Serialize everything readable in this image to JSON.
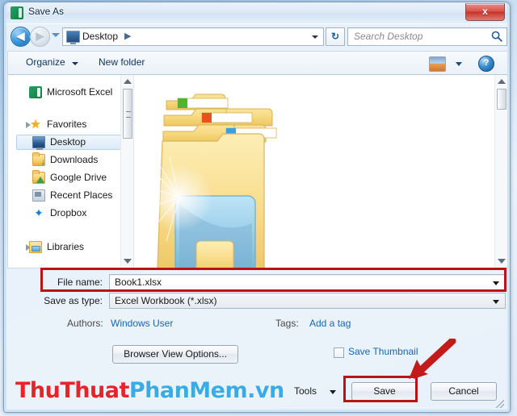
{
  "window": {
    "title": "Save As",
    "app_icon": "excel-icon",
    "close_label": "x"
  },
  "navigation": {
    "back_glyph": "◀",
    "forward_glyph": "▶",
    "address_text": "Desktop",
    "address_separator": "▶",
    "refresh_glyph": "↻",
    "search_placeholder": "Search Desktop"
  },
  "toolbar": {
    "organize_label": "Organize",
    "new_folder_label": "New folder",
    "help_label": "?"
  },
  "sidebar": {
    "header": {
      "label": "Microsoft Excel",
      "icon": "excel-icon"
    },
    "groups": [
      {
        "label": "Favorites",
        "icon": "star-icon",
        "items": [
          {
            "label": "Desktop",
            "icon": "desktop-icon",
            "selected": true
          },
          {
            "label": "Downloads",
            "icon": "downloads-folder-icon",
            "selected": false
          },
          {
            "label": "Google Drive",
            "icon": "google-drive-icon",
            "selected": false
          },
          {
            "label": "Recent Places",
            "icon": "recent-places-icon",
            "selected": false
          },
          {
            "label": "Dropbox",
            "icon": "dropbox-icon",
            "selected": false
          }
        ]
      },
      {
        "label": "Libraries",
        "icon": "library-icon",
        "items": []
      }
    ]
  },
  "form": {
    "filename_label": "File name:",
    "filename_value": "Book1.xlsx",
    "savetype_label": "Save as type:",
    "savetype_value": "Excel Workbook (*.xlsx)",
    "authors_label": "Authors:",
    "authors_value": "Windows User",
    "tags_label": "Tags:",
    "tags_value": "Add a tag"
  },
  "actions": {
    "browser_view_options": "Browser View Options...",
    "save_thumbnail_label": "Save Thumbnail",
    "save_thumbnail_checked": false,
    "tools_label": "Tools",
    "save_label": "Save",
    "cancel_label": "Cancel"
  },
  "watermark": {
    "red_text": "ThuThuat",
    "blue_text": "PhanMem.vn"
  },
  "colors": {
    "annotation_red": "#b81414",
    "link_blue": "#1667b3",
    "excel_green": "#107c41",
    "watermark_red": "#e8232a",
    "watermark_blue": "#39abe8"
  }
}
